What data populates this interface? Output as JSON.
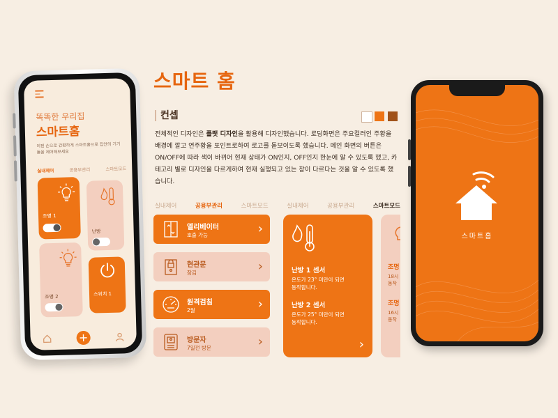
{
  "page": {
    "title": "스마트 홈",
    "concept_heading": "컨셉"
  },
  "palette": [
    "#ffffff",
    "#ee7415",
    "#a0521a"
  ],
  "concept": {
    "p1": "전체적인 디자인은 ",
    "p1_bold": "플랫 디자인",
    "p2": "을 활용해 디자인했습니다. 로딩화면은 주요컬러인 주황을 배경에 깔고 연주황을 포인트로하여 로고를 돋보이도록 했습니다. 메인 화면의 버튼은 ON/OFF에 따라 색이 바뀌어 현재 상태가 ON인지, OFF인지 한눈에 알 수 있도록 했고, 카테고리 별로 디자인을 다르게하여 현재 실행되고 있는 창이 다르다는 것을 알 수 있도록 했습니다."
  },
  "left_phone": {
    "greeting": "똑똑한 우리집",
    "title": "스마트홈",
    "description": "이젠 손으로 간편하게 스마트홈으로 집안의 기기들을 제어해보세요",
    "tabs": [
      "실내제어",
      "공용부관리",
      "스마트모드"
    ],
    "cards": {
      "light1": "조명 1",
      "heating": "난방",
      "light2": "조명 2",
      "switch1": "스위치 1"
    },
    "nav_icons": [
      "home-icon",
      "plus-icon",
      "user-icon"
    ],
    "plus": "+"
  },
  "middle": {
    "tabs": [
      "실내제어",
      "공용부관리",
      "스마트모드",
      "실내제어",
      "공용부관리",
      "스마트모드"
    ],
    "rows": [
      {
        "title": "엘리베이터",
        "subtitle": "호출 가능",
        "icon": "elevator-icon"
      },
      {
        "title": "현관문",
        "subtitle": "잠김",
        "icon": "door-lock-icon"
      },
      {
        "title": "원격검침",
        "subtitle": "2월",
        "icon": "gauge-icon"
      },
      {
        "title": "방문자",
        "subtitle": "7일전 방문",
        "icon": "intercom-icon"
      }
    ],
    "chevron": "›",
    "heating_card": {
      "sensor1_title": "난방 1 센서",
      "sensor1_desc1": "온도가 23° 미만이 되면",
      "sensor1_desc2": "동작합니다.",
      "sensor2_title": "난방 2 센서",
      "sensor2_desc1": "온도가 25° 미만이 되면",
      "sensor2_desc2": "동작합니다."
    },
    "peek_card": {
      "a": "조명",
      "a1": "18시",
      "a2": "동작",
      "b": "조명",
      "b1": "16시",
      "b2": "동작"
    }
  },
  "right_phone": {
    "app_name": "스마트홈"
  }
}
